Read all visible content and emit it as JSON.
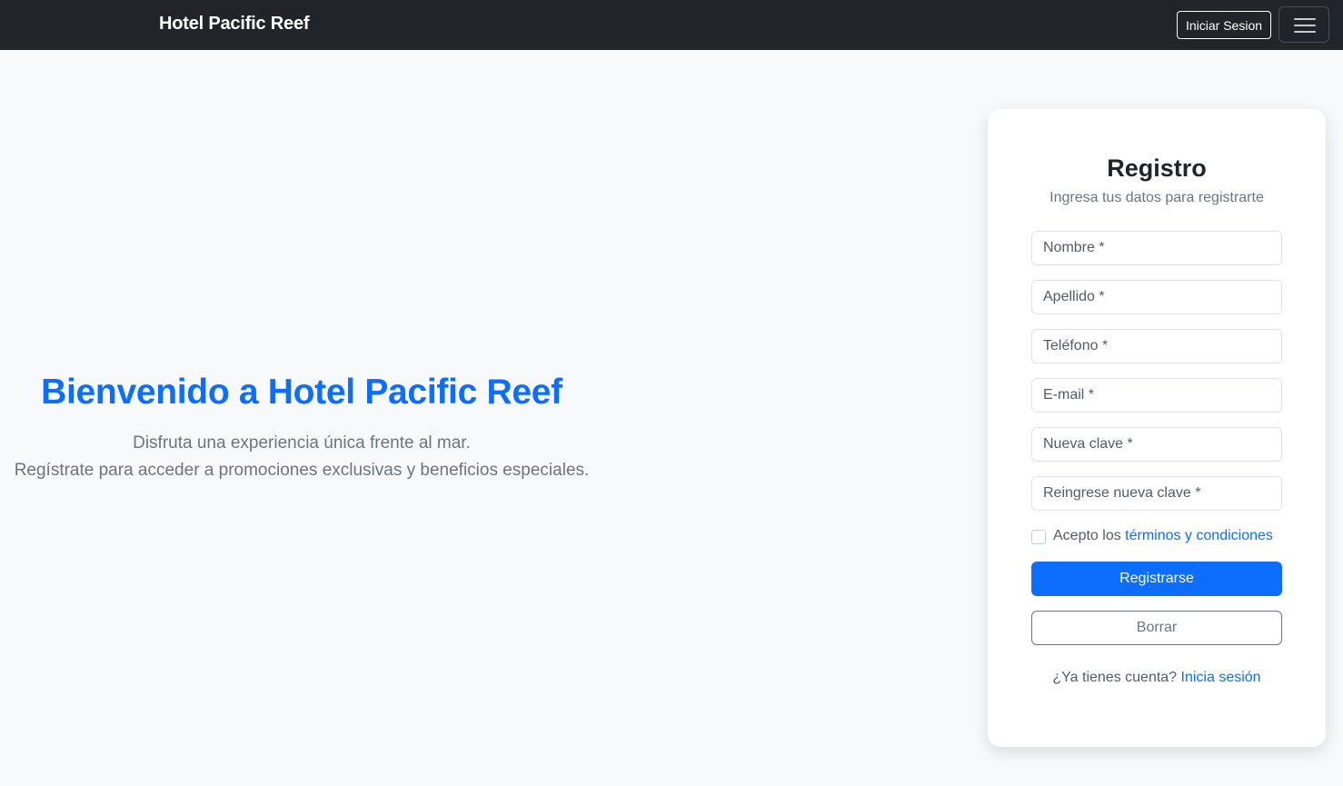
{
  "navbar": {
    "brand": "Hotel Pacific Reef",
    "login_label": "Iniciar Sesion",
    "menu_icon": "hamburger-menu-icon"
  },
  "hero": {
    "title": "Bienvenido a Hotel Pacific Reef",
    "line1": "Disfruta una experiencia única frente al mar.",
    "line2": "Regístrate para acceder a promociones exclusivas y beneficios especiales."
  },
  "form": {
    "title": "Registro",
    "subtitle": "Ingresa tus datos para registrarte",
    "fields": [
      {
        "placeholder": "Nombre *",
        "value": ""
      },
      {
        "placeholder": "Apellido *",
        "value": ""
      },
      {
        "placeholder": "Teléfono *",
        "value": ""
      },
      {
        "placeholder": "E-mail *",
        "value": ""
      },
      {
        "placeholder": "Nueva clave *",
        "value": ""
      },
      {
        "placeholder": "Reingrese nueva clave *",
        "value": ""
      }
    ],
    "terms_prefix": "Acepto los ",
    "terms_link": "términos y condiciones",
    "terms_checked": false,
    "submit_label": "Registrarse",
    "clear_label": "Borrar",
    "account_prompt": "¿Ya tienes cuenta? ",
    "account_link": "Inicia sesión"
  },
  "colors": {
    "navbar": "#212529",
    "accent": "#0d6efd",
    "muted_text": "#6c757d",
    "page_background": "#f8f9fa"
  }
}
